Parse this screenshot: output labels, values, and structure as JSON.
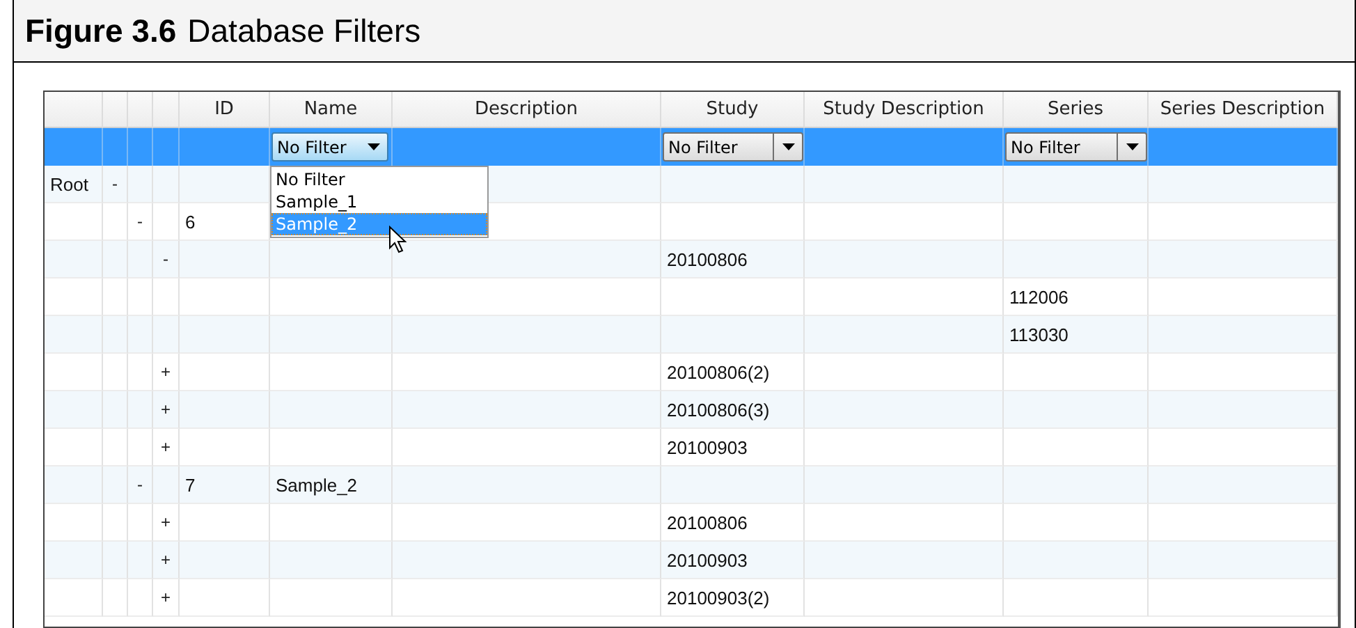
{
  "figure": {
    "label": "Figure 3.6",
    "title": "Database Filters"
  },
  "grid": {
    "columns": [
      {
        "label": "ID"
      },
      {
        "label": "Name",
        "filter": {
          "value": "No Filter",
          "expanded": true,
          "options": [
            {
              "label": "No Filter",
              "highlighted": false
            },
            {
              "label": "Sample_1",
              "highlighted": false
            },
            {
              "label": "Sample_2",
              "highlighted": true
            }
          ]
        }
      },
      {
        "label": "Description"
      },
      {
        "label": "Study",
        "filter": {
          "value": "No Filter",
          "expanded": false
        }
      },
      {
        "label": "Study Description"
      },
      {
        "label": "Series",
        "filter": {
          "value": "No Filter",
          "expanded": false
        }
      },
      {
        "label": "Series Description"
      }
    ],
    "tree": [
      {
        "label": "Root",
        "expander": "-",
        "children": [
          {
            "expander": "-",
            "id": "6",
            "children": [
              {
                "expander": "-",
                "study": "20100806",
                "children": [
                  {
                    "series": "112006"
                  },
                  {
                    "series": "113030"
                  }
                ]
              },
              {
                "expander": "+",
                "study": "20100806(2)"
              },
              {
                "expander": "+",
                "study": "20100806(3)"
              },
              {
                "expander": "+",
                "study": "20100903"
              }
            ]
          },
          {
            "expander": "-",
            "id": "7",
            "name": "Sample_2",
            "children": [
              {
                "expander": "+",
                "study": "20100806"
              },
              {
                "expander": "+",
                "study": "20100903"
              },
              {
                "expander": "+",
                "study": "20100903(2)"
              }
            ]
          }
        ]
      }
    ]
  }
}
